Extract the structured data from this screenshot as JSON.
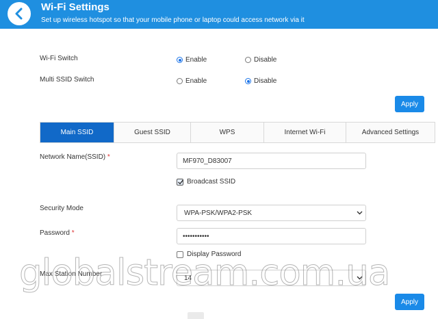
{
  "header": {
    "title": "Wi-Fi Settings",
    "subtitle": "Set up wireless hotspot so that your mobile phone or laptop could access network via it",
    "color": "#1f8fe0"
  },
  "wifi_switch": {
    "label": "Wi-Fi Switch",
    "options": [
      "Enable",
      "Disable"
    ],
    "selected": "Enable"
  },
  "multi_ssid_switch": {
    "label": "Multi SSID Switch",
    "options": [
      "Enable",
      "Disable"
    ],
    "selected": "Disable"
  },
  "apply_label": "Apply",
  "tabs": [
    {
      "label": "Main SSID",
      "active": true
    },
    {
      "label": "Guest SSID",
      "active": false
    },
    {
      "label": "WPS",
      "active": false
    },
    {
      "label": "Internet Wi-Fi",
      "active": false
    },
    {
      "label": "Advanced Settings",
      "active": false
    }
  ],
  "form": {
    "ssid_label": "Network Name(SSID)",
    "ssid_value": "MF970_D83007",
    "broadcast_label": "Broadcast SSID",
    "broadcast_checked": true,
    "security_label": "Security Mode",
    "security_value": "WPA-PSK/WPA2-PSK",
    "password_label": "Password",
    "password_value": "•••••••••••",
    "display_password_label": "Display Password",
    "display_password_checked": false,
    "max_station_label": "Max Station Number",
    "max_station_value": "14",
    "required_mark": "*"
  },
  "watermark": "globalstream.com.ua",
  "accent_color": "#1a8ae8",
  "active_tab_color": "#1169c8"
}
